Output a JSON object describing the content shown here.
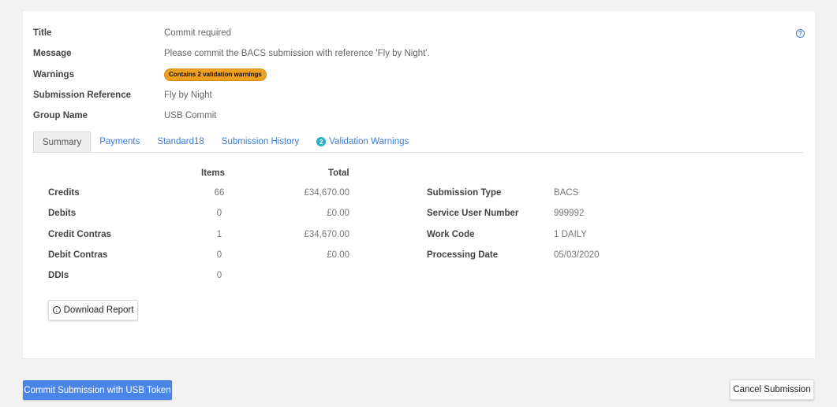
{
  "details": {
    "title_label": "Title",
    "title_value": "Commit required",
    "message_label": "Message",
    "message_value": "Please commit the BACS submission with reference 'Fly by Night'.",
    "warnings_label": "Warnings",
    "warnings_badge": "Contains 2 validation warnings",
    "reference_label": "Submission Reference",
    "reference_value": "Fly by Night",
    "group_label": "Group Name",
    "group_value": "USB Commit"
  },
  "help_icon": "question-circle-icon",
  "tabs": [
    {
      "label": "Summary",
      "active": true
    },
    {
      "label": "Payments"
    },
    {
      "label": "Standard18"
    },
    {
      "label": "Submission History"
    },
    {
      "label": "Validation Warnings",
      "count": "2"
    }
  ],
  "summary": {
    "items_header": "Items",
    "total_header": "Total",
    "rows": [
      {
        "label": "Credits",
        "items": "66",
        "total": "£34,670.00"
      },
      {
        "label": "Debits",
        "items": "0",
        "total": "£0.00"
      },
      {
        "label": "Credit Contras",
        "items": "1",
        "total": "£34,670.00"
      },
      {
        "label": "Debit Contras",
        "items": "0",
        "total": "£0.00"
      },
      {
        "label": "DDIs",
        "items": "0",
        "total": ""
      }
    ],
    "info": [
      {
        "label": "Submission Type",
        "value": "BACS"
      },
      {
        "label": "Service User Number",
        "value": "999992"
      },
      {
        "label": "Work Code",
        "value": "1 DAILY"
      },
      {
        "label": "Processing Date",
        "value": "05/03/2020"
      }
    ],
    "download_label": "Download Report",
    "download_icon": "download-circle-icon"
  },
  "actions": {
    "commit_label": "Commit Submission with USB Token",
    "cancel_label": "Cancel Submission"
  },
  "colors": {
    "primary": "#4a86e8",
    "link": "#3d7bd9",
    "warning_badge": "#f0a020",
    "count_badge": "#2bb0c8",
    "page_background": "#f2f2f2"
  }
}
